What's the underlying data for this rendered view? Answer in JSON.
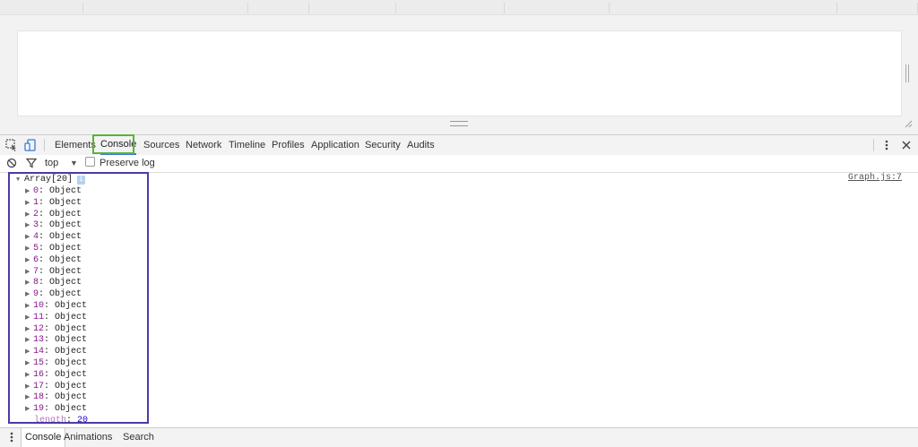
{
  "devtools_tabs": [
    {
      "label": "Elements"
    },
    {
      "label": "Console"
    },
    {
      "label": "Sources"
    },
    {
      "label": "Network"
    },
    {
      "label": "Timeline"
    },
    {
      "label": "Profiles"
    },
    {
      "label": "Application"
    },
    {
      "label": "Security"
    },
    {
      "label": "Audits"
    }
  ],
  "active_tab": "Console",
  "filter_bar": {
    "context": "top",
    "preserve_log_label": "Preserve log",
    "preserve_log_checked": false
  },
  "console": {
    "source_link": "Graph.js:7",
    "array_label": "Array[20]",
    "info_badge": "i",
    "items": [
      {
        "key": "0",
        "value": "Object"
      },
      {
        "key": "1",
        "value": "Object"
      },
      {
        "key": "2",
        "value": "Object"
      },
      {
        "key": "3",
        "value": "Object"
      },
      {
        "key": "4",
        "value": "Object"
      },
      {
        "key": "5",
        "value": "Object"
      },
      {
        "key": "6",
        "value": "Object"
      },
      {
        "key": "7",
        "value": "Object"
      },
      {
        "key": "8",
        "value": "Object"
      },
      {
        "key": "9",
        "value": "Object"
      },
      {
        "key": "10",
        "value": "Object"
      },
      {
        "key": "11",
        "value": "Object"
      },
      {
        "key": "12",
        "value": "Object"
      },
      {
        "key": "13",
        "value": "Object"
      },
      {
        "key": "14",
        "value": "Object"
      },
      {
        "key": "15",
        "value": "Object"
      },
      {
        "key": "16",
        "value": "Object"
      },
      {
        "key": "17",
        "value": "Object"
      },
      {
        "key": "18",
        "value": "Object"
      },
      {
        "key": "19",
        "value": "Object"
      }
    ],
    "length_key": "length",
    "length_value": "20"
  },
  "drawer_tabs": [
    {
      "label": "Console"
    },
    {
      "label": "Animations"
    },
    {
      "label": "Search"
    }
  ],
  "colors": {
    "console_highlight": "#5ab437",
    "array_highlight": "#4b3aa8",
    "property_key": "#881391",
    "number": "#1c00cf"
  }
}
